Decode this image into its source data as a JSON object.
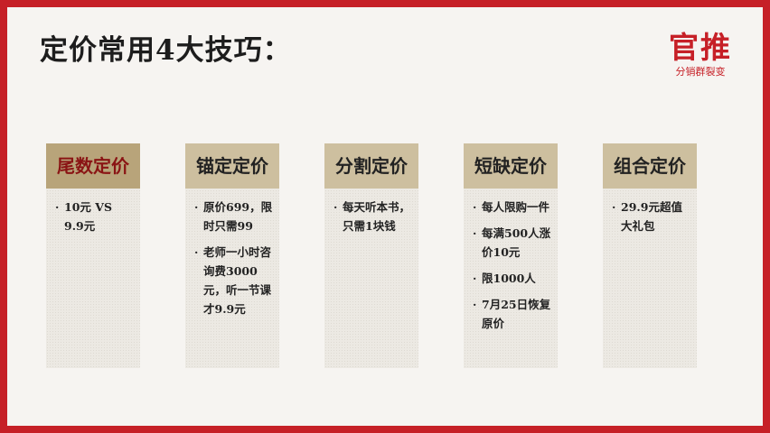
{
  "title": "定价常用4大技巧：",
  "logo": {
    "main": "官推",
    "sub": "分销群裂变"
  },
  "cards": [
    {
      "head": "尾数定价",
      "items": [
        "10元 VS 9.9元"
      ]
    },
    {
      "head": "锚定定价",
      "items": [
        "原价699，限时只需99",
        "老师一小时咨询费3000元，听一节课才9.9元"
      ]
    },
    {
      "head": "分割定价",
      "items": [
        "每天听本书，只需1块钱"
      ]
    },
    {
      "head": "短缺定价",
      "items": [
        "每人限购一件",
        "每满500人涨价10元",
        "限1000人",
        "7月25日恢复原价"
      ]
    },
    {
      "head": "组合定价",
      "items": [
        "29.9元超值大礼包"
      ]
    }
  ],
  "colors": {
    "border": "#c62027",
    "card_head": "#cdbf9f",
    "highlight_head": "#b8a47a",
    "highlight_text": "#8a1414"
  }
}
